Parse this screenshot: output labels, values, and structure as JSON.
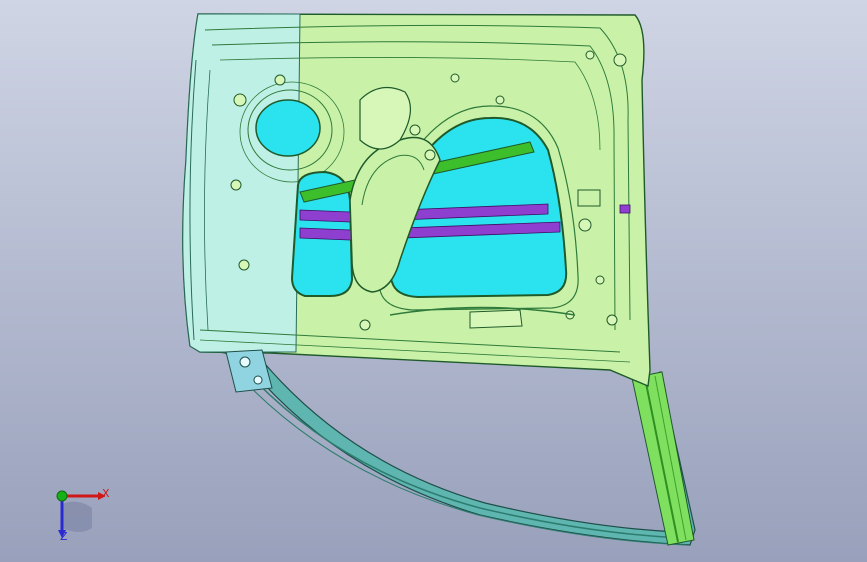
{
  "viewport": {
    "background_top": "#cfd5e4",
    "background_bottom": "#98a0bb"
  },
  "model": {
    "name": "door-inner-panel",
    "colors": {
      "panel": "#c9f2a8",
      "panel_dark": "#a5e07f",
      "hinge_side": "#bff0e6",
      "opening": "#2be3ee",
      "rail": "#8f3fd0",
      "bar": "#3cbf2a",
      "edge": "#1f5a2a"
    }
  },
  "triad": {
    "x_label": "X",
    "z_label": "Z",
    "x_color": "#d01818",
    "y_color": "#18b018",
    "z_color": "#2a2ad0"
  }
}
